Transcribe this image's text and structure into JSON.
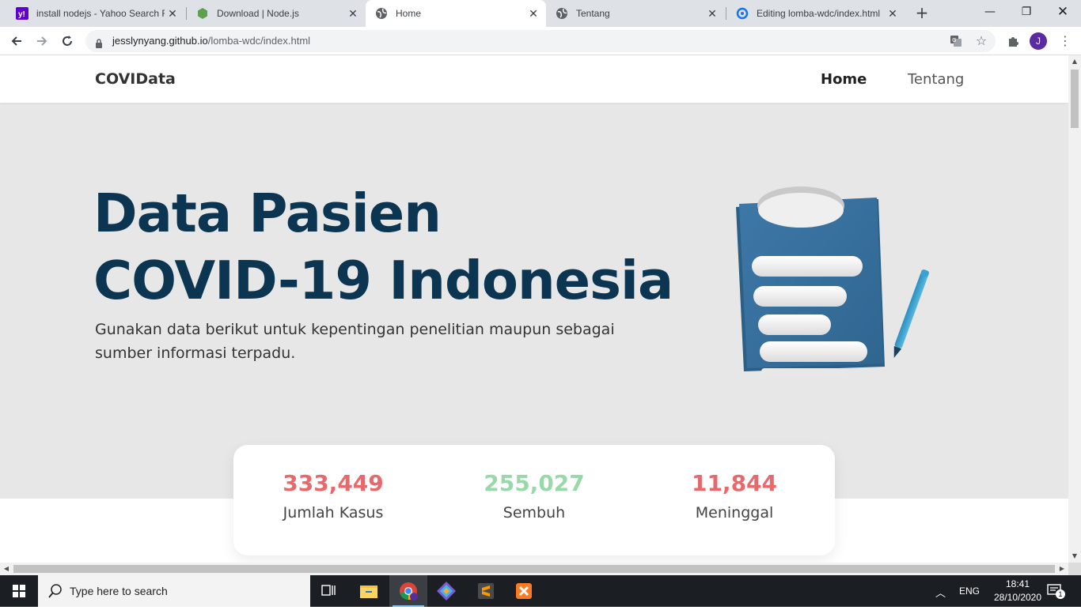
{
  "browser": {
    "tabs": [
      {
        "title": "install nodejs - Yahoo Search Re",
        "icon": "yahoo-icon",
        "active": false
      },
      {
        "title": "Download | Node.js",
        "icon": "nodejs-icon",
        "active": false
      },
      {
        "title": "Home",
        "icon": "globe-icon",
        "active": true
      },
      {
        "title": "Tentang",
        "icon": "globe-icon",
        "active": false
      },
      {
        "title": "Editing lomba-wdc/index.html",
        "icon": "loading-icon",
        "active": false
      }
    ],
    "new_tab": "+",
    "url_domain": "jesslynyang.github.io",
    "url_path": "/lomba-wdc/index.html",
    "avatar_letter": "J"
  },
  "site": {
    "brand": "COVIData",
    "nav": [
      {
        "label": "Home",
        "active": true
      },
      {
        "label": "Tentang",
        "active": false
      }
    ],
    "hero": {
      "title_line1": "Data Pasien",
      "title_line2": "COVID-19 Indonesia",
      "subtitle": "Gunakan data berikut untuk kepentingan penelitian maupun sebagai sumber informasi terpadu."
    },
    "stats": [
      {
        "value": "333,449",
        "label": "Jumlah Kasus",
        "color": "#e8696b"
      },
      {
        "value": "255,027",
        "label": "Sembuh",
        "color": "#98d8a9"
      },
      {
        "value": "11,844",
        "label": "Meninggal",
        "color": "#e8696b"
      }
    ]
  },
  "taskbar": {
    "search_placeholder": "Type here to search",
    "language": "ENG",
    "time": "18:41",
    "date": "28/10/2020",
    "notification_count": "1"
  }
}
